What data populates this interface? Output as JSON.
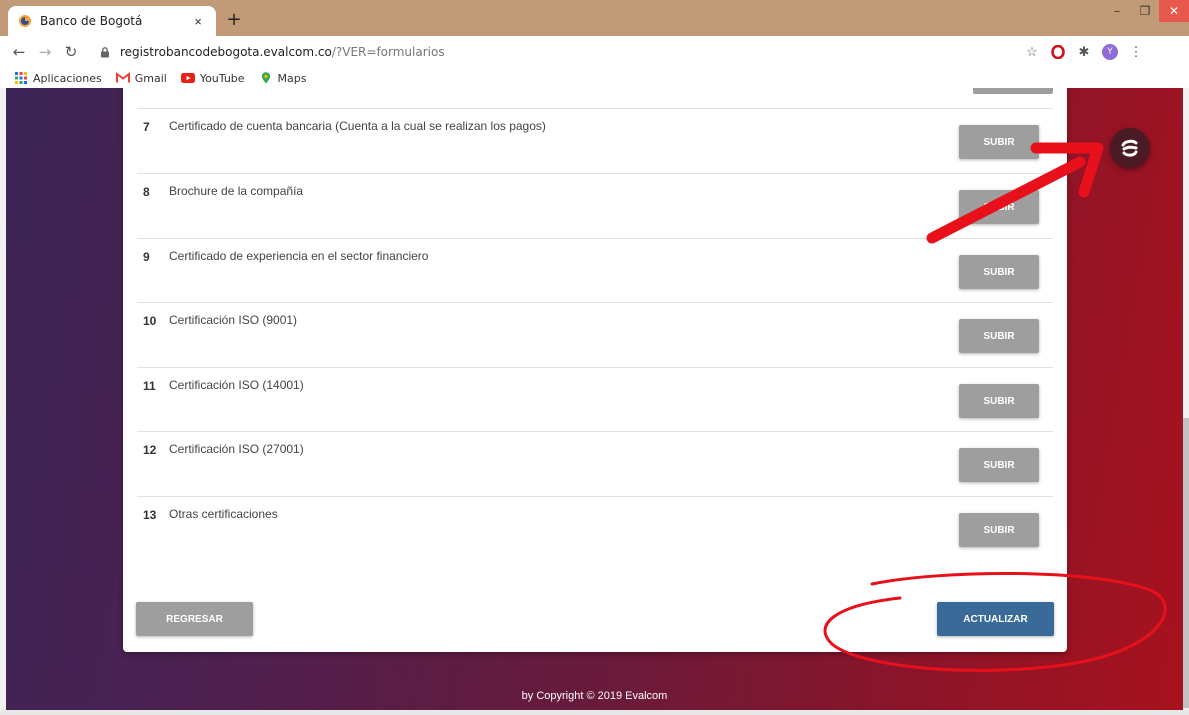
{
  "browser": {
    "tab_title": "Banco de Bogotá",
    "tab_close": "×",
    "new_tab": "+",
    "url_host": "registrobancodebogota.evalcom.co",
    "url_path": "/?VER=formularios",
    "bookmarks": [
      {
        "label": "Aplicaciones",
        "icon": "apps-grid-icon"
      },
      {
        "label": "Gmail",
        "icon": "gmail-icon"
      },
      {
        "label": "YouTube",
        "icon": "youtube-icon"
      },
      {
        "label": "Maps",
        "icon": "maps-icon"
      }
    ],
    "profile_initial": "Y"
  },
  "form": {
    "rows": [
      {
        "num": "7",
        "label": "Certificado de cuenta bancaria (Cuenta a la cual se realizan los pagos)",
        "button": "SUBIR"
      },
      {
        "num": "8",
        "label": "Brochure de la compañía",
        "button": "SUBIR"
      },
      {
        "num": "9",
        "label": "Certificado de experiencia en el sector financiero",
        "button": "SUBIR"
      },
      {
        "num": "10",
        "label": "Certificación ISO (9001)",
        "button": "SUBIR"
      },
      {
        "num": "11",
        "label": "Certificación ISO (14001)",
        "button": "SUBIR"
      },
      {
        "num": "12",
        "label": "Certificación ISO (27001)",
        "button": "SUBIR"
      },
      {
        "num": "13",
        "label": "Otras certificaciones",
        "button": "SUBIR"
      }
    ],
    "back_button": "REGRESAR",
    "update_button": "ACTUALIZAR"
  },
  "footer": {
    "copyright": "by Copyright © 2019 Evalcom"
  },
  "colors": {
    "subir_button": "#9e9e9e",
    "update_button": "#3a6a98",
    "annotation_red": "#e8101a"
  }
}
